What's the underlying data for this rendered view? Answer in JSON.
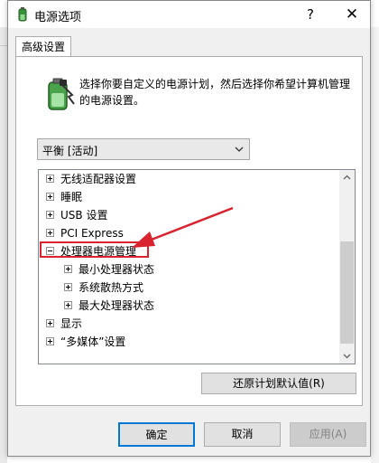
{
  "window": {
    "title": "电源选项",
    "help_label": "?",
    "close_label": "✕"
  },
  "tabs": [
    {
      "label": "高级设置",
      "active": true
    }
  ],
  "description": "选择你要自定义的电源计划，然后选择你希望计算机管理的电源设置。",
  "plan_select": {
    "value": "平衡 [活动]"
  },
  "tree": {
    "items": [
      {
        "label": "无线适配器设置",
        "expanded": false,
        "level": 0
      },
      {
        "label": "睡眠",
        "expanded": false,
        "level": 0
      },
      {
        "label": "USB 设置",
        "expanded": false,
        "level": 0
      },
      {
        "label": "PCI Express",
        "expanded": false,
        "level": 0
      },
      {
        "label": "处理器电源管理",
        "expanded": true,
        "level": 0,
        "highlighted": true
      },
      {
        "label": "最小处理器状态",
        "expanded": false,
        "level": 1
      },
      {
        "label": "系统散热方式",
        "expanded": false,
        "level": 1
      },
      {
        "label": "最大处理器状态",
        "expanded": false,
        "level": 1
      },
      {
        "label": "显示",
        "expanded": false,
        "level": 0
      },
      {
        "label": "“多媒体”设置",
        "expanded": false,
        "level": 0
      }
    ]
  },
  "buttons": {
    "restore": "还原计划默认值(R)",
    "ok": "确定",
    "cancel": "取消",
    "apply": "应用(A)"
  },
  "colors": {
    "annotation_red": "#d9232e",
    "focus_blue": "#0078d7"
  }
}
